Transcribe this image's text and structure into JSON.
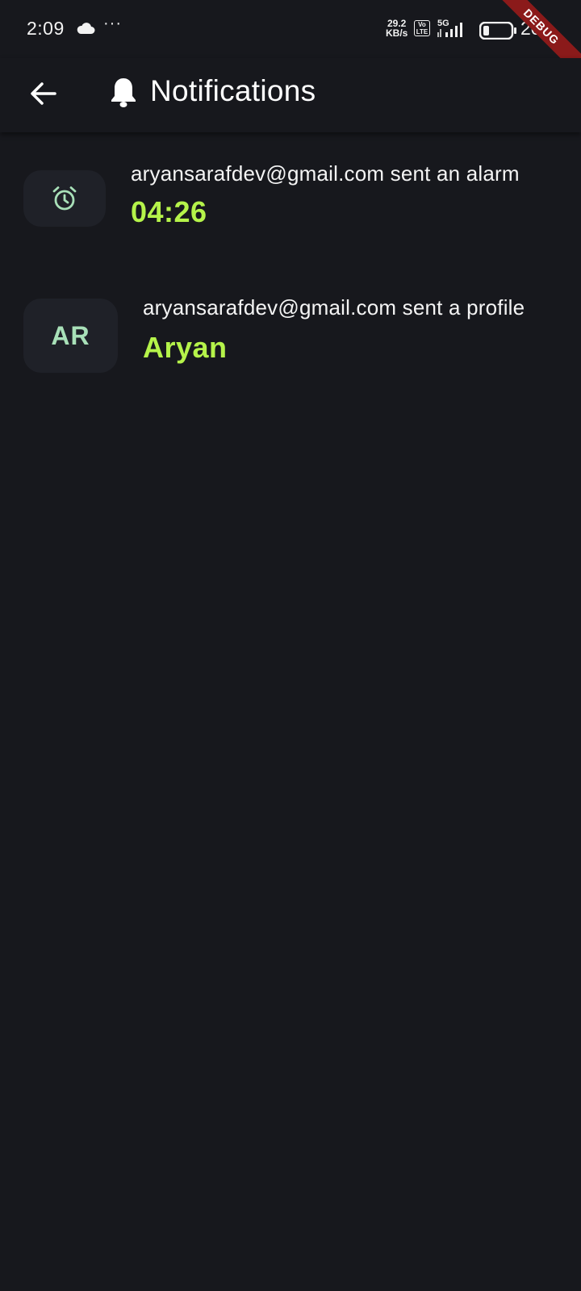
{
  "status_bar": {
    "time": "2:09",
    "overflow_dots": "···",
    "net_speed_value": "29.2",
    "net_speed_unit": "KB/s",
    "volte_top": "Vo",
    "volte_bottom": "LTE",
    "network_type": "5G",
    "battery_level": "20",
    "icons": [
      "cloud-icon",
      "volte-icon",
      "signal-icon",
      "battery-icon"
    ]
  },
  "debug_banner": {
    "label": "DEBUG"
  },
  "app_bar": {
    "title": "Notifications",
    "icons": [
      "back-arrow-icon",
      "bell-icon"
    ]
  },
  "notifications": [
    {
      "icon": "alarm-clock-icon",
      "message": "aryansarafdev@gmail.com sent an alarm",
      "highlight": "04:26"
    },
    {
      "avatar_initials": "AR",
      "message": "aryansarafdev@gmail.com sent a profile",
      "highlight": "Aryan"
    }
  ],
  "colors": {
    "background": "#17181d",
    "badge_background": "#1f2128",
    "accent_green": "#b5f34a",
    "icon_mint": "#a8e0b8",
    "debug_red": "#8b1a1a"
  }
}
